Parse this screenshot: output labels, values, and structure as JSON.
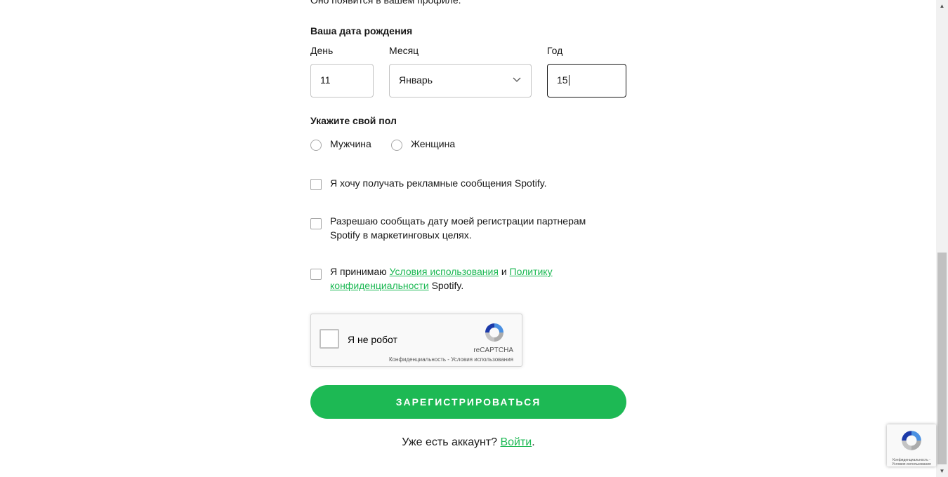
{
  "form": {
    "cut_off_text": "Оно появится в вашем профиле.",
    "birthdate": {
      "title": "Ваша дата рождения",
      "day_label": "День",
      "day_value": "11",
      "month_label": "Месяц",
      "month_value": "Январь",
      "year_label": "Год",
      "year_value": "15"
    },
    "gender": {
      "title": "Укажите свой пол",
      "options": [
        "Мужчина",
        "Женщина"
      ]
    },
    "marketing_checkbox": "Я хочу получать рекламные сообщения Spotify.",
    "share_checkbox": "Разрешаю сообщать дату моей регистрации партнерам Spotify в маркетинговых целях.",
    "terms": {
      "prefix": "Я принимаю",
      "terms_link": "Условия использования",
      "and": "и",
      "privacy_link": "Политику конфиденциальности",
      "suffix": "Spotify."
    },
    "recaptcha": {
      "label": "Я не робот",
      "brand": "reCAPTCHA",
      "terms": "Конфиденциальность - Условия использования"
    },
    "submit_label": "ЗАРЕГИСТРИРОВАТЬСЯ",
    "login": {
      "question": "Уже есть аккаунт?",
      "link": "Войти",
      "suffix": "."
    }
  },
  "recaptcha_badge": {
    "text": "Конфиденциальность - Условия использования"
  },
  "colors": {
    "accent": "#1db954",
    "text": "#181818",
    "border": "#c4c4c4"
  },
  "icons": {
    "month_dropdown": "chevron-down-icon",
    "recaptcha": "recaptcha-logo-icon"
  }
}
